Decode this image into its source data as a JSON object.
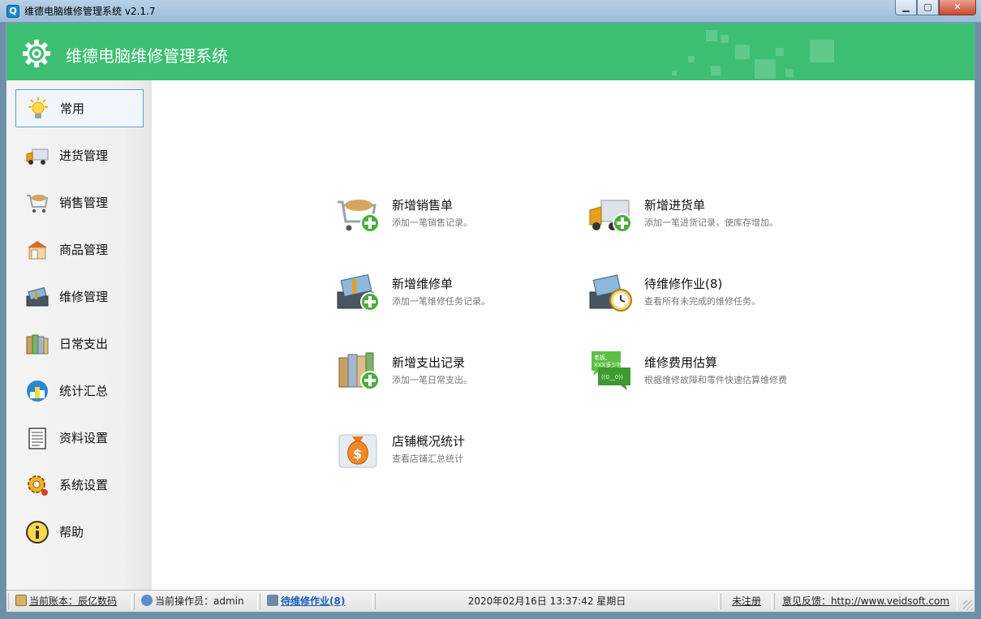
{
  "window": {
    "title": "维德电脑维修管理系统    v2.1.7",
    "min_glyph": "▁",
    "max_glyph": "▢",
    "close_glyph": "✕"
  },
  "header": {
    "title": "维德电脑维修管理系统",
    "accent_color": "#3cbf72"
  },
  "sidebar": {
    "items": [
      {
        "label": "常用",
        "icon": "lightbulb-icon"
      },
      {
        "label": "进货管理",
        "icon": "truck-icon"
      },
      {
        "label": "销售管理",
        "icon": "shopping-cart-icon"
      },
      {
        "label": "商品管理",
        "icon": "store-icon"
      },
      {
        "label": "维修管理",
        "icon": "toolbox-icon"
      },
      {
        "label": "日常支出",
        "icon": "binders-icon"
      },
      {
        "label": "统计汇总",
        "icon": "podium-icon"
      },
      {
        "label": "资料设置",
        "icon": "document-icon"
      },
      {
        "label": "系统设置",
        "icon": "gear-icon"
      },
      {
        "label": "帮助",
        "icon": "info-icon"
      }
    ],
    "active_index": 0
  },
  "tiles": [
    {
      "title": "新增销售单",
      "desc": "添加一笔销售记录。",
      "icon": "cart-add-icon"
    },
    {
      "title": "新增进货单",
      "desc": "添加一笔进货记录，使库存增加。",
      "icon": "truck-add-icon"
    },
    {
      "title": "新增维修单",
      "desc": "添加一笔维修任务记录。",
      "icon": "toolbox-add-icon"
    },
    {
      "title": "待维修作业(8)",
      "desc": "查看所有未完成的维修任务。",
      "icon": "toolbox-clock-icon"
    },
    {
      "title": "新增支出记录",
      "desc": "添加一笔日常支出。",
      "icon": "binders-add-icon"
    },
    {
      "title": "维修费用估算",
      "desc": "根据维修故障和零件快速估算维修费",
      "icon": "chat-bubbles-icon",
      "bubble_text_1": "老板,",
      "bubble_text_2": "XXX多少钱",
      "bubble_text_3": "((0__0))"
    },
    {
      "title": "店铺概况统计",
      "desc": "查看店铺汇总统计",
      "icon": "money-bag-icon"
    }
  ],
  "statusbar": {
    "account": "当前账本：辰亿数码",
    "operator": "当前操作员：admin",
    "pending": "待维修作业(8)",
    "datetime": "2020年02月16日 13:37:42 星期日",
    "register": "未注册",
    "feedback": "意见反馈：http://www.veidsoft.com"
  }
}
